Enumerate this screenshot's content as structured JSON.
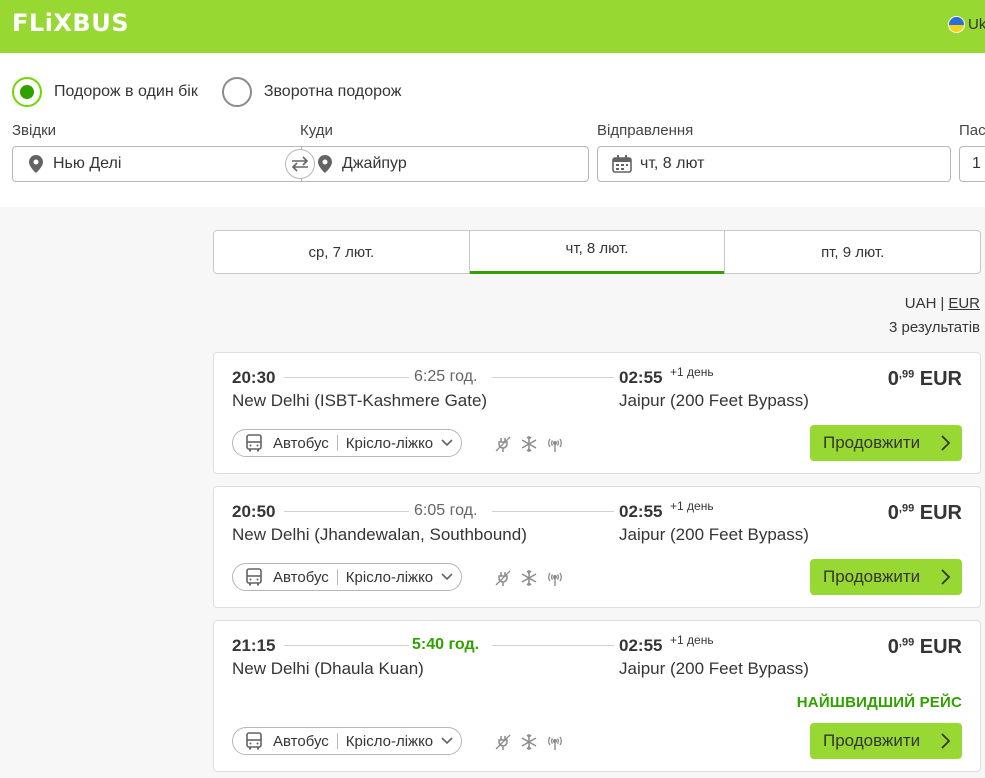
{
  "header": {
    "logo": "FLiXBUS",
    "language": "Uk"
  },
  "search": {
    "trip_types": [
      {
        "label": "Подорож в один бік",
        "selected": true
      },
      {
        "label": "Зворотна подорож",
        "selected": false
      }
    ],
    "from_label": "Звідки",
    "from_value": "Нью Делі",
    "to_label": "Куди",
    "to_value": "Джайпур",
    "departure_label": "Відправлення",
    "departure_value": "чт, 8 лют",
    "passengers_label": "Пас",
    "passengers_value": "1"
  },
  "date_tabs": [
    {
      "label": "ср, 7 лют.",
      "active": false
    },
    {
      "label": "чт, 8 лют.",
      "active": true
    },
    {
      "label": "пт, 9 лют.",
      "active": false
    }
  ],
  "currency": {
    "uah": "UAH",
    "separator": "|",
    "eur": "EUR"
  },
  "results_count": "3 результатів",
  "results": [
    {
      "dep_time": "20:30",
      "duration": "6:25 год.",
      "arr_time": "02:55",
      "plus_day": "+1 день",
      "dep_station": "New Delhi (ISBT-Kashmere Gate)",
      "arr_station": "Jaipur (200 Feet Bypass)",
      "price_main": "0",
      "price_cents": ",99",
      "price_currency": "EUR",
      "vehicle": "Автобус",
      "seat": "Крісло-ліжко",
      "button": "Продовжити",
      "badge": ""
    },
    {
      "dep_time": "20:50",
      "duration": "6:05 год.",
      "arr_time": "02:55",
      "plus_day": "+1 день",
      "dep_station": "New Delhi (Jhandewalan, Southbound)",
      "arr_station": "Jaipur (200 Feet Bypass)",
      "price_main": "0",
      "price_cents": ",99",
      "price_currency": "EUR",
      "vehicle": "Автобус",
      "seat": "Крісло-ліжко",
      "button": "Продовжити",
      "badge": ""
    },
    {
      "dep_time": "21:15",
      "duration": "5:40 год.",
      "arr_time": "02:55",
      "plus_day": "+1 день",
      "dep_station": "New Delhi (Dhaula Kuan)",
      "arr_station": "Jaipur (200 Feet Bypass)",
      "price_main": "0",
      "price_cents": ",99",
      "price_currency": "EUR",
      "vehicle": "Автобус",
      "seat": "Крісло-ліжко",
      "button": "Продовжити",
      "badge": "НАЙШВИДШИЙ РЕЙС"
    }
  ],
  "colors": {
    "brand": "#97d833",
    "accent": "#31a100",
    "text": "#353535"
  },
  "icons": [
    "location-pin-icon",
    "swap-icon",
    "calendar-icon",
    "bus-icon",
    "chevron-down-icon",
    "power-socket-icon",
    "air-conditioning-icon",
    "wifi-icon",
    "chevron-right-icon"
  ]
}
